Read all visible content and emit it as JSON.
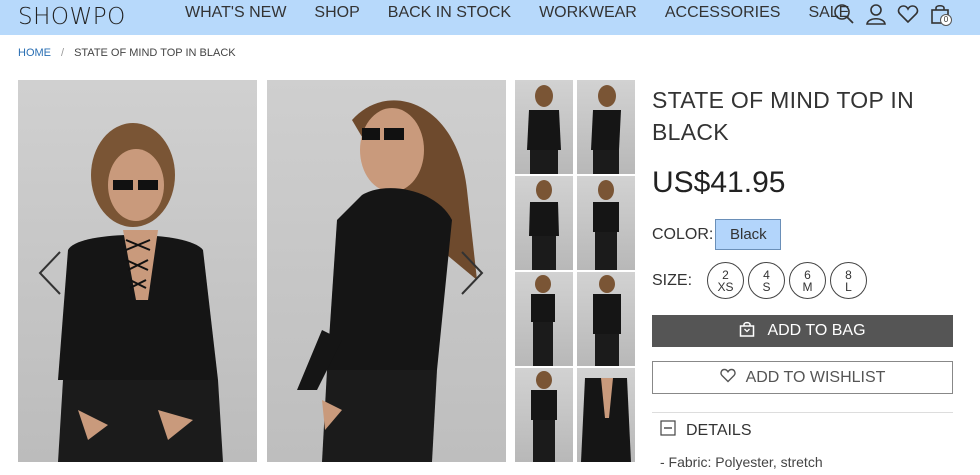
{
  "header": {
    "logo": "SHOWPO",
    "nav": [
      "WHAT'S NEW",
      "SHOP",
      "BACK IN STOCK",
      "WORKWEAR",
      "ACCESSORIES",
      "SALE"
    ],
    "cart_count": "0",
    "icons": [
      "search-icon",
      "account-icon",
      "wishlist-heart-icon",
      "cart-bag-icon"
    ],
    "background_color": "#b7d9fb"
  },
  "breadcrumb": {
    "home": "HOME",
    "separator": "/",
    "current": "STATE OF MIND TOP IN BLACK"
  },
  "product": {
    "title": "STATE OF MIND TOP IN BLACK",
    "price": "US$41.95",
    "color_label": "COLOR:",
    "color_value": "Black",
    "size_label": "SIZE:",
    "sizes": [
      {
        "top": "2",
        "bottom": "XS"
      },
      {
        "top": "4",
        "bottom": "S"
      },
      {
        "top": "6",
        "bottom": "M"
      },
      {
        "top": "8",
        "bottom": "L"
      }
    ],
    "add_to_bag": "ADD TO BAG",
    "add_to_wishlist": "ADD TO WISHLIST",
    "details_label": "DETAILS",
    "details_first_line": "- Fabric: Polyester, stretch"
  },
  "colors": {
    "swatch_selected": "#b3d5fb",
    "button_dark": "#555555",
    "link": "#2a6fb3"
  }
}
